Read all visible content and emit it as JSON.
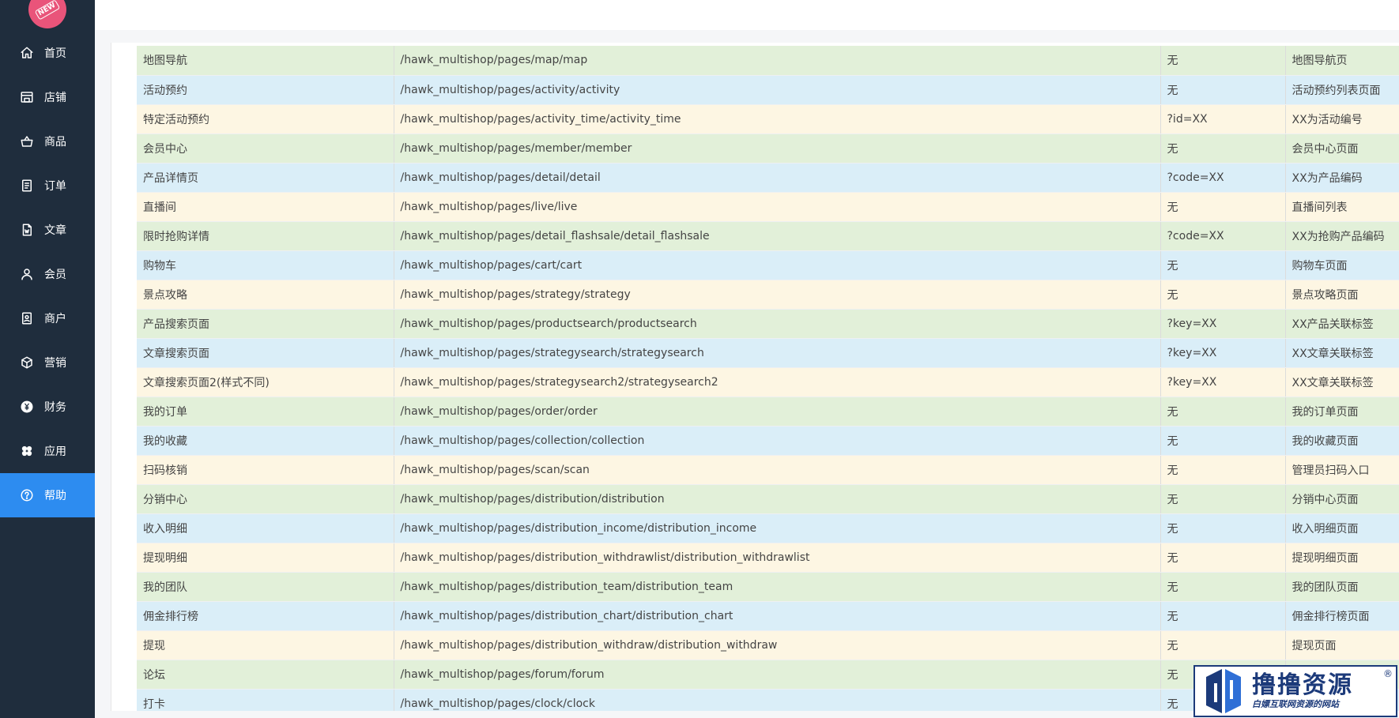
{
  "logo": {
    "badge": "NEW"
  },
  "sidebar": {
    "items": [
      {
        "label": "首页",
        "icon": "home-icon"
      },
      {
        "label": "店铺",
        "icon": "store-icon"
      },
      {
        "label": "商品",
        "icon": "basket-icon"
      },
      {
        "label": "订单",
        "icon": "order-icon"
      },
      {
        "label": "文章",
        "icon": "article-icon"
      },
      {
        "label": "会员",
        "icon": "user-icon"
      },
      {
        "label": "商户",
        "icon": "merchant-icon"
      },
      {
        "label": "营销",
        "icon": "marketing-icon"
      },
      {
        "label": "财务",
        "icon": "finance-icon"
      },
      {
        "label": "应用",
        "icon": "apps-icon"
      },
      {
        "label": "帮助",
        "icon": "help-icon",
        "active": true
      }
    ]
  },
  "table": {
    "rows": [
      [
        "地图导航",
        "/hawk_multishop/pages/map/map",
        "无",
        "地图导航页"
      ],
      [
        "活动预约",
        "/hawk_multishop/pages/activity/activity",
        "无",
        "活动预约列表页面"
      ],
      [
        "特定活动预约",
        "/hawk_multishop/pages/activity_time/activity_time",
        "?id=XX",
        "XX为活动编号"
      ],
      [
        "会员中心",
        "/hawk_multishop/pages/member/member",
        "无",
        "会员中心页面"
      ],
      [
        "产品详情页",
        "/hawk_multishop/pages/detail/detail",
        "?code=XX",
        "XX为产品编码"
      ],
      [
        "直播间",
        "/hawk_multishop/pages/live/live",
        "无",
        "直播间列表"
      ],
      [
        "限时抢购详情",
        "/hawk_multishop/pages/detail_flashsale/detail_flashsale",
        "?code=XX",
        "XX为抢购产品编码"
      ],
      [
        "购物车",
        "/hawk_multishop/pages/cart/cart",
        "无",
        "购物车页面"
      ],
      [
        "景点攻略",
        "/hawk_multishop/pages/strategy/strategy",
        "无",
        "景点攻略页面"
      ],
      [
        "产品搜索页面",
        "/hawk_multishop/pages/productsearch/productsearch",
        "?key=XX",
        "XX产品关联标签"
      ],
      [
        "文章搜索页面",
        "/hawk_multishop/pages/strategysearch/strategysearch",
        "?key=XX",
        "XX文章关联标签"
      ],
      [
        "文章搜索页面2(样式不同)",
        "/hawk_multishop/pages/strategysearch2/strategysearch2",
        "?key=XX",
        "XX文章关联标签"
      ],
      [
        "我的订单",
        "/hawk_multishop/pages/order/order",
        "无",
        "我的订单页面"
      ],
      [
        "我的收藏",
        "/hawk_multishop/pages/collection/collection",
        "无",
        "我的收藏页面"
      ],
      [
        "扫码核销",
        "/hawk_multishop/pages/scan/scan",
        "无",
        "管理员扫码入口"
      ],
      [
        "分销中心",
        "/hawk_multishop/pages/distribution/distribution",
        "无",
        "分销中心页面"
      ],
      [
        "收入明细",
        "/hawk_multishop/pages/distribution_income/distribution_income",
        "无",
        "收入明细页面"
      ],
      [
        "提现明细",
        "/hawk_multishop/pages/distribution_withdrawlist/distribution_withdrawlist",
        "无",
        "提现明细页面"
      ],
      [
        "我的团队",
        "/hawk_multishop/pages/distribution_team/distribution_team",
        "无",
        "我的团队页面"
      ],
      [
        "佣金排行榜",
        "/hawk_multishop/pages/distribution_chart/distribution_chart",
        "无",
        "佣金排行榜页面"
      ],
      [
        "提现",
        "/hawk_multishop/pages/distribution_withdraw/distribution_withdraw",
        "无",
        "提现页面"
      ],
      [
        "论坛",
        "/hawk_multishop/pages/forum/forum",
        "无",
        ""
      ],
      [
        "打卡",
        "/hawk_multishop/pages/clock/clock",
        "无",
        ""
      ]
    ]
  },
  "watermark": {
    "title": "撸撸资源",
    "subtitle": "白嫖互联网资源的网站",
    "reg": "®"
  },
  "colors": {
    "sidebar_bg": "#1f2d3d",
    "active": "#2d8cf0",
    "row_green": "#e2f0d9",
    "row_blue": "#daeef8",
    "row_yellow": "#fdf6e3"
  }
}
